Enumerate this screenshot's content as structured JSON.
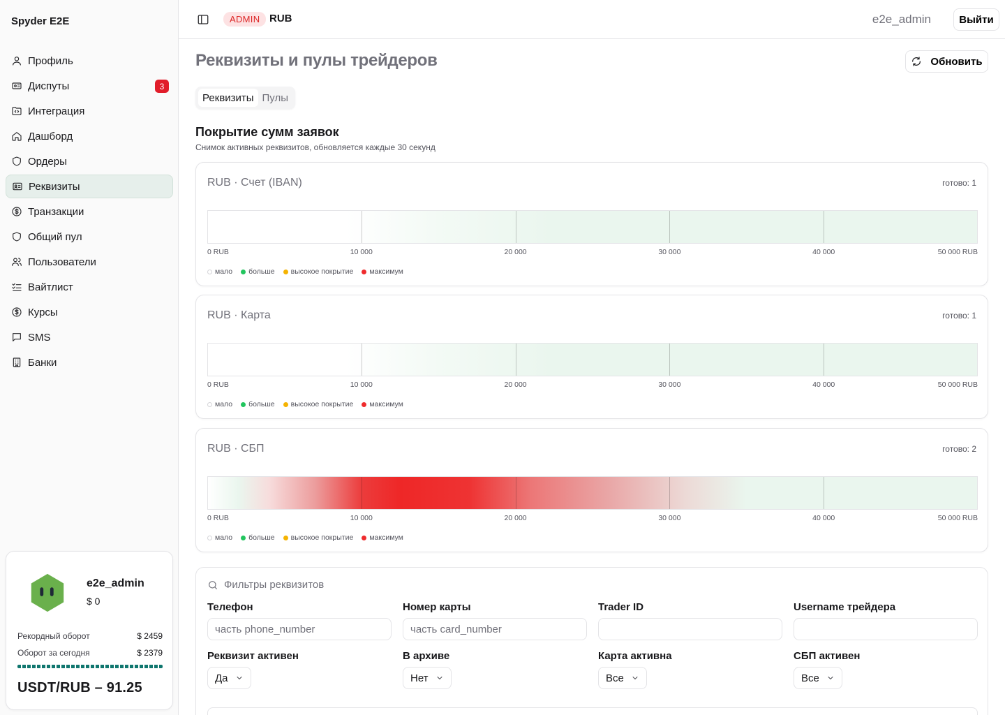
{
  "app": {
    "brand": "Spyder E2E"
  },
  "sidebar": {
    "items": [
      {
        "label": "Профиль",
        "icon": "user-icon"
      },
      {
        "label": "Диспуты",
        "icon": "ticket-icon",
        "badge": "3"
      },
      {
        "label": "Интеграция",
        "icon": "folder-code-icon"
      },
      {
        "label": "Дашборд",
        "icon": "home-icon"
      },
      {
        "label": "Ордеры",
        "icon": "shield-icon"
      },
      {
        "label": "Реквизиты",
        "icon": "id-card-icon",
        "active": true
      },
      {
        "label": "Транзакции",
        "icon": "dollar-circle-icon"
      },
      {
        "label": "Общий пул",
        "icon": "shield-icon"
      },
      {
        "label": "Пользователи",
        "icon": "users-icon"
      },
      {
        "label": "Вайтлист",
        "icon": "list-checks-icon"
      },
      {
        "label": "Курсы",
        "icon": "dollar-circle-icon"
      },
      {
        "label": "SMS",
        "icon": "message-square-icon"
      },
      {
        "label": "Банки",
        "icon": "building-icon"
      }
    ],
    "user_card": {
      "name": "e2e_admin",
      "balance": "$ 0",
      "record_label": "Рекордный оборот",
      "record_value": "$ 2459",
      "today_label": "Оборот за сегодня",
      "today_value": "$ 2379",
      "rate": "USDT/RUB – 91.25"
    }
  },
  "topbar": {
    "role": "ADMIN",
    "currency": "RUB",
    "username": "e2e_admin",
    "logout_label": "Выйти"
  },
  "page": {
    "title": "Реквизиты и пулы трейдеров",
    "refresh_label": "Обновить",
    "tabs": [
      {
        "label": "Реквизиты",
        "active": true
      },
      {
        "label": "Пулы",
        "active": false
      }
    ],
    "coverage": {
      "title": "Покрытие сумм заявок",
      "subtitle": "Снимок активных реквизитов, обновляется каждые 30 секунд",
      "ticks": [
        "0 RUB",
        "10 000",
        "20 000",
        "30 000",
        "40 000",
        "50 000 RUB"
      ],
      "legend": [
        {
          "label": "мало",
          "color": "#ffffff"
        },
        {
          "label": "больше",
          "color": "#22c55e"
        },
        {
          "label": "высокое покрытие",
          "color": "#f5b301"
        },
        {
          "label": "максимум",
          "color": "#ef2b2d"
        }
      ],
      "cards": [
        {
          "title": "RUB · Счет (IBAN)",
          "ready": "готово: 1",
          "heat": "low"
        },
        {
          "title": "RUB · Карта",
          "ready": "готово: 1",
          "heat": "low"
        },
        {
          "title": "RUB · СБП",
          "ready": "готово: 2",
          "heat": "high"
        }
      ]
    },
    "filters": {
      "title": "Фильтры реквизитов",
      "phone_label": "Телефон",
      "phone_placeholder": "часть phone_number",
      "card_label": "Номер карты",
      "card_placeholder": "часть card_number",
      "trader_id_label": "Trader ID",
      "trader_id_placeholder": "",
      "trader_username_label": "Username трейдера",
      "trader_username_placeholder": "",
      "active_label": "Реквизит активен",
      "active_value": "Да",
      "archive_label": "В архиве",
      "archive_value": "Нет",
      "card_active_label": "Карта активна",
      "card_active_value": "Все",
      "sbp_active_label": "СБП активен",
      "sbp_active_value": "Все"
    }
  }
}
